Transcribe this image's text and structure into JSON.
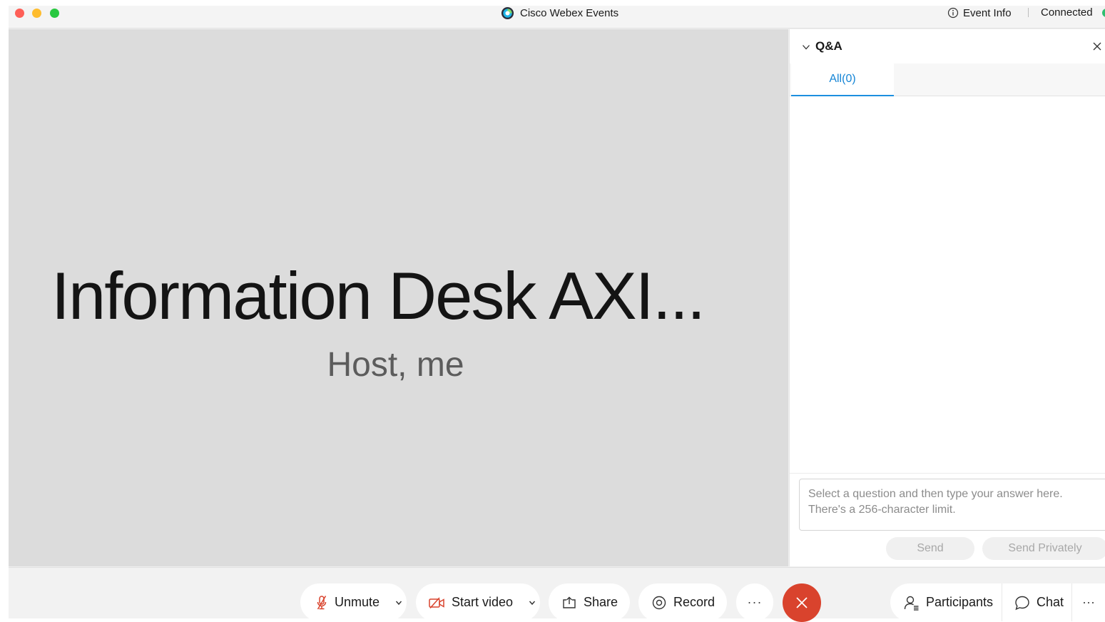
{
  "titlebar": {
    "app_title": "Cisco Webex Events",
    "event_info_label": "Event Info",
    "connection_status": "Connected"
  },
  "stage": {
    "participant_name": "Information Desk AXI...",
    "participant_role": "Host, me"
  },
  "qa_panel": {
    "title": "Q&A",
    "tabs": [
      {
        "label": "All(0)",
        "active": true
      }
    ],
    "answer_placeholder": "Select a question and then type your answer here. There's a 256-character limit.",
    "send_label": "Send",
    "send_privately_label": "Send Privately"
  },
  "controls": {
    "unmute_label": "Unmute",
    "start_video_label": "Start video",
    "share_label": "Share",
    "record_label": "Record",
    "more_label": "···",
    "participants_label": "Participants",
    "chat_label": "Chat",
    "overflow_label": "···"
  },
  "icons": {
    "mute": "mic-muted-icon",
    "video": "video-off-icon",
    "share": "share-icon",
    "record": "record-icon",
    "leave": "close-icon",
    "participants": "participants-icon",
    "chat": "chat-bubble-icon",
    "info": "info-icon",
    "collapse": "chevron-down-icon",
    "close": "close-icon"
  },
  "colors": {
    "accent": "#1585d6",
    "leave": "#d9432d",
    "muted_icon": "#d9432d",
    "status_online": "#2fbf71"
  }
}
